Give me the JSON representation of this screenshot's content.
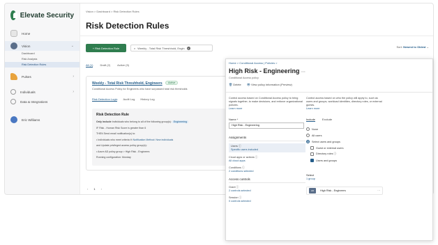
{
  "brand": {
    "name": "Elevate Security"
  },
  "sidebar": {
    "items": [
      {
        "label": "Home",
        "color": "#e6e6e6"
      },
      {
        "label": "Vision",
        "color": "#5a6e8a",
        "subitems": [
          "Dashboard",
          "Risk Analysis",
          "Risk Detection Rules"
        ]
      },
      {
        "label": "Pulses",
        "color": "#e8a33d"
      },
      {
        "label": "Individuals",
        "color": "#cfcfcf"
      },
      {
        "label": "Data & Integrations",
        "color": "#cfcfcf"
      },
      {
        "label": "Eric Williams",
        "color": "#4a78c2"
      }
    ]
  },
  "main": {
    "breadcrumb": "Vision > Dashboard > Risk Detection Rules",
    "title": "Risk Detection Rules",
    "new_button": "+ Risk Detection Rule",
    "search_value": "Weekly - Total Risk Threshhold, Engin",
    "sort_label": "Sort:",
    "sort_value": "Newest to Oldest",
    "tabs": [
      "All (1)",
      "Draft (2)",
      "Active (9)"
    ],
    "card": {
      "title": "Weekly - Total Risk Threshhold, Engineers",
      "badge": "Active",
      "description": "Conditional Access Policy for Engineers who have surpassed total risk thresholds",
      "tabs": [
        "Risk Detection Logic",
        "Audit Log",
        "History Log"
      ],
      "rule": {
        "heading": "Risk Detection Rule",
        "line1_prefix": "Only include",
        "line1_text": "Individuals who belong to all of the following group(s):",
        "line1_chip": "Engineering",
        "line2": "IF  Risk - Human Risk Score is greater than 6",
        "line3": "THEN  Send email notification(s) to:",
        "line4_a": "• Individuals who meet criteria",
        "line4_b": "Notification Method: New individuals",
        "line5": "and  Update privileged access policy group(s):",
        "line6": "• Azure AD policy group > High Risk - Engineers",
        "line7": "Running configuration: Monday"
      }
    },
    "pager": [
      "‹",
      "1",
      "›"
    ]
  },
  "panel": {
    "breadcrumb": "Home > Conditional Access | Policies >",
    "title": "High Risk - Engineering",
    "subtitle": "Conditional Access policy",
    "delete_label": "Delete",
    "view_info_label": "View policy information (Preview)",
    "left_desc": "Control access based on Conditional Access policy to bring signals together, to make decisions, and enforce organizational policies.",
    "left_learn": "Learn more",
    "right_desc": "Control access based on who the policy will apply to, such as users and groups, workload identities, directory roles, or external guests.",
    "right_learn": "Learn more",
    "name_label": "Name *",
    "name_value": "High Risk - Engineering",
    "assignments": "Assignments",
    "users_label": "Users ⓘ",
    "users_value": "Specific users included",
    "cloud_label": "Cloud apps or actions ⓘ",
    "cloud_value": "All cloud apps",
    "conditions_label": "Conditions ⓘ",
    "conditions_value": "2 conditions selected",
    "access_controls": "Access controls",
    "grant_label": "Grant ⓘ",
    "grant_value": "2 controls selected",
    "session_label": "Session ⓘ",
    "session_value": "0 controls selected",
    "include_tab": "Include",
    "exclude_tab": "Exclude",
    "opt_none": "None",
    "opt_all": "All users",
    "opt_select": "Select users and groups",
    "chk_guest": "Guest or external users",
    "chk_dir": "Directory roles ⓘ",
    "chk_users": "Users and groups",
    "select_label": "Select",
    "select_value": "1 group",
    "group_initials": "HR",
    "group_name": "High Risk - Engineers",
    "more": "···"
  }
}
